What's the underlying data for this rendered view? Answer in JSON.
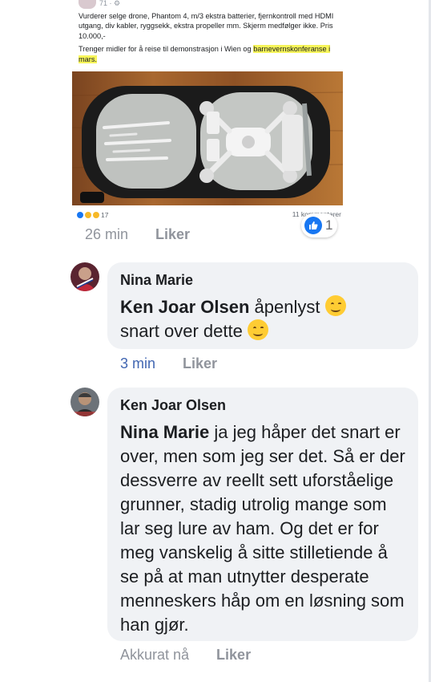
{
  "post": {
    "header_meta": "71 · ⚙",
    "text_line1": "Vurderer selge drone, Phantom 4, m/3 ekstra batterier, fjernkontroll med HDMI utgang, div kabler, ryggsekk, ekstra propeller mm. Skjerm medfølger ikke. Pris 10.000,-",
    "text_line2_prefix": "Trenger midler for å reise til demonstrasjon i Wien og ",
    "text_line2_highlight": "barnevernskonferanse i mars.",
    "reaction_count": "17",
    "comments_count": "11 kommentarer",
    "time": "26 min",
    "like_label": "Liker",
    "bubble_reaction_count": "1"
  },
  "comments": [
    {
      "author": "Nina Marie",
      "mention": "Ken Joar Olsen",
      "text_part1": " åpenlyst ",
      "text_part2": "snart over dette ",
      "time": "3 min",
      "like_label": "Liker"
    },
    {
      "author": "Ken Joar Olsen",
      "mention": "Nina Marie",
      "text": " ja jeg håper det snart er over, men som jeg ser det. Så er der dessverre av reellt sett uforståelige grunner, stadig utrolig mange som lar seg lure av ham. Og det er for meg vanskelig å sitte stilletiende å se på at man utnytter desperate menneskers håp om en løsning som han gjør.",
      "time": "Akkurat nå",
      "like_label": "Liker"
    }
  ],
  "colors": {
    "link_blue": "#4267b2",
    "bubble_bg": "#f0f2f5",
    "meta_gray": "#90949c",
    "like_blue": "#1877f2"
  }
}
